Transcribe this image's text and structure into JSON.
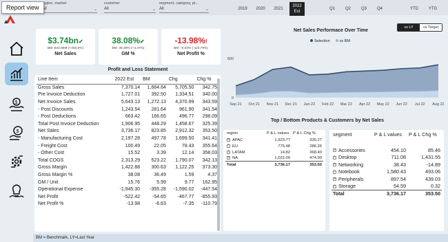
{
  "tooltip": "Report view",
  "slicers": [
    {
      "label": "region, market",
      "value": "All"
    },
    {
      "label": "customer",
      "value": "All"
    },
    {
      "label": "segment, category, pr...",
      "value": "All"
    }
  ],
  "years": [
    "2019",
    "2020",
    "2021",
    "2022",
    "Est"
  ],
  "quarters": [
    "Q1",
    "Q2",
    "Q3",
    "Q4"
  ],
  "period_buttons": [
    "YTD",
    "YTG"
  ],
  "kpis": [
    {
      "value": "$3.74bn",
      "arrow": "✔",
      "sub": "BM: 823.85M (+353.5%)",
      "name": "Net Sales",
      "color": "#1b8a3a"
    },
    {
      "value": "38.08%",
      "arrow": "✔",
      "sub": "BM: 36.49% (+4.37%)",
      "name": "GM %",
      "color": "#1b8a3a"
    },
    {
      "value": "-13.98%",
      "arrow": "!",
      "sub": "BM: -6.63% (-110.79%)",
      "name": "Net Profit %",
      "color": "#d42a2a"
    }
  ],
  "pl": {
    "title": "Profit and Loss Statement",
    "headers": [
      "Line Item",
      "2022 Est",
      "BM",
      "Chg",
      "Chg %"
    ],
    "rows": [
      [
        "Gross Sales",
        "7,370.14",
        "1,664.64",
        "5,705.50",
        "342.75"
      ],
      [
        "Pre Invoice Deduction",
        "1,727.01",
        "392.50",
        "1,334.51",
        "340.00"
      ],
      [
        "Net Invoice Sales",
        "5,643.13",
        "1,272.13",
        "4,370.99",
        "343.59"
      ],
      [
        "- Post Discounts",
        "1,243.54",
        "281.64",
        "961.90",
        "341.54"
      ],
      [
        "- Post Deductions",
        "663.42",
        "166.65",
        "496.77",
        "298.09"
      ],
      [
        "Total Post Invoice Deduction",
        "1,906.95",
        "448.29",
        "1,458.67",
        "325.39"
      ],
      [
        "Net Sales",
        "3,736.17",
        "823.85",
        "2,912.32",
        "353.50"
      ],
      [
        "- Manufacturing Cost",
        "2,197.28",
        "497.78",
        "1,699.50",
        "341.41"
      ],
      [
        "- Freight Cost",
        "100.49",
        "22.05",
        "78.43",
        "355.64"
      ],
      [
        "- Other Cost",
        "15.52",
        "3.39",
        "12.14",
        "358.03"
      ],
      [
        "Total COGS",
        "2,313.29",
        "523.22",
        "1,790.07",
        "342.13"
      ],
      [
        "Gross Margin",
        "1,422.88",
        "300.63",
        "1,122.25",
        "373.30"
      ],
      [
        "Gross Margin %",
        "38.08",
        "36.49",
        "1.59",
        "4.37"
      ],
      [
        "GM / Unit",
        "15.76",
        "5.99",
        "9.77",
        "162.95"
      ],
      [
        "Operational Expense",
        "-1,945.30",
        "-355.28",
        "-1,590.02",
        "-447.54"
      ],
      [
        "Net Profit",
        "-522.42",
        "-54.65",
        "-467.77",
        "-855.93"
      ],
      [
        "Net Profit %",
        "-13.98",
        "-6.63",
        "-7.35",
        "-110.79"
      ]
    ]
  },
  "toggle": {
    "active": "vs LY",
    "inactive": "vs Target"
  },
  "chart_data": {
    "type": "area",
    "title": "Net Sales Performace Over Time",
    "legend": [
      "Selection",
      "vs BM"
    ],
    "x": [
      "Sep 21",
      "Oct 21",
      "Nov 21",
      "Dec 21",
      "Jan 22",
      "Feb 22",
      "Mar 22",
      "Apr 22",
      "May 22",
      "Jun 22",
      "Jul 22",
      "Aug 22"
    ],
    "yticks": [
      "500",
      "0"
    ],
    "ylim": [
      0,
      650
    ],
    "series": [
      {
        "name": "Selection",
        "values": [
          150,
          230,
          360,
          390,
          290,
          300,
          330,
          340,
          350,
          370,
          380,
          420
        ]
      },
      {
        "name": "vs BM",
        "values": [
          35,
          50,
          80,
          85,
          60,
          65,
          70,
          72,
          75,
          80,
          82,
          90
        ]
      }
    ],
    "colors": {
      "selection_fill": "#8aa1be",
      "selection_line": "#344d6b",
      "bm_fill": "#c6d7ea",
      "bm_line": "#9bb8d8"
    }
  },
  "bottom_title": "Top / Bottom Products & Customers by Net Sales",
  "region_table": {
    "headers": [
      "region",
      "P & L values",
      "P & L Chg %"
    ],
    "rows": [
      [
        "APAC",
        "1,923.77",
        "335.27"
      ],
      [
        "EU",
        "775.48",
        "286.26"
      ],
      [
        "LATAM",
        "14.82",
        "368.40"
      ],
      [
        "NA",
        "1,022.09",
        "474.90"
      ]
    ],
    "total": [
      "Total",
      "3,736.17",
      "353.50"
    ]
  },
  "segment_table": {
    "headers": [
      "segment",
      "P & L values",
      "P & L Chg %"
    ],
    "rows": [
      [
        "Accessories",
        "454.10",
        "85.46"
      ],
      [
        "Desktop",
        "711.08",
        "1,431.55"
      ],
      [
        "Networking",
        "38.43",
        "-14.89"
      ],
      [
        "Notebook",
        "1,580.43",
        "493.06"
      ],
      [
        "Peripherals",
        "897.54",
        "439.03"
      ],
      [
        "Storage",
        "54.59",
        "0.32"
      ]
    ],
    "total": [
      "Total",
      "3,736.17",
      "353.50"
    ]
  },
  "footer": "BM = Benchmark, LY=Last Year",
  "nav_icons": [
    "home-icon",
    "chart-growth-icon",
    "finance-icon",
    "coins-icon",
    "settings-gear-icon",
    "lightbulb-icon"
  ]
}
